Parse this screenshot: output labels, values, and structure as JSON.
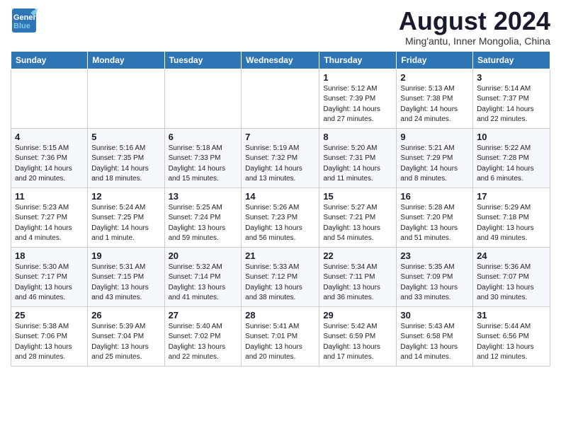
{
  "header": {
    "logo_line1": "General",
    "logo_line2": "Blue",
    "month_year": "August 2024",
    "location": "Ming'antu, Inner Mongolia, China"
  },
  "weekdays": [
    "Sunday",
    "Monday",
    "Tuesday",
    "Wednesday",
    "Thursday",
    "Friday",
    "Saturday"
  ],
  "weeks": [
    [
      {
        "day": "",
        "info": ""
      },
      {
        "day": "",
        "info": ""
      },
      {
        "day": "",
        "info": ""
      },
      {
        "day": "",
        "info": ""
      },
      {
        "day": "1",
        "info": "Sunrise: 5:12 AM\nSunset: 7:39 PM\nDaylight: 14 hours\nand 27 minutes."
      },
      {
        "day": "2",
        "info": "Sunrise: 5:13 AM\nSunset: 7:38 PM\nDaylight: 14 hours\nand 24 minutes."
      },
      {
        "day": "3",
        "info": "Sunrise: 5:14 AM\nSunset: 7:37 PM\nDaylight: 14 hours\nand 22 minutes."
      }
    ],
    [
      {
        "day": "4",
        "info": "Sunrise: 5:15 AM\nSunset: 7:36 PM\nDaylight: 14 hours\nand 20 minutes."
      },
      {
        "day": "5",
        "info": "Sunrise: 5:16 AM\nSunset: 7:35 PM\nDaylight: 14 hours\nand 18 minutes."
      },
      {
        "day": "6",
        "info": "Sunrise: 5:18 AM\nSunset: 7:33 PM\nDaylight: 14 hours\nand 15 minutes."
      },
      {
        "day": "7",
        "info": "Sunrise: 5:19 AM\nSunset: 7:32 PM\nDaylight: 14 hours\nand 13 minutes."
      },
      {
        "day": "8",
        "info": "Sunrise: 5:20 AM\nSunset: 7:31 PM\nDaylight: 14 hours\nand 11 minutes."
      },
      {
        "day": "9",
        "info": "Sunrise: 5:21 AM\nSunset: 7:29 PM\nDaylight: 14 hours\nand 8 minutes."
      },
      {
        "day": "10",
        "info": "Sunrise: 5:22 AM\nSunset: 7:28 PM\nDaylight: 14 hours\nand 6 minutes."
      }
    ],
    [
      {
        "day": "11",
        "info": "Sunrise: 5:23 AM\nSunset: 7:27 PM\nDaylight: 14 hours\nand 4 minutes."
      },
      {
        "day": "12",
        "info": "Sunrise: 5:24 AM\nSunset: 7:25 PM\nDaylight: 14 hours\nand 1 minute."
      },
      {
        "day": "13",
        "info": "Sunrise: 5:25 AM\nSunset: 7:24 PM\nDaylight: 13 hours\nand 59 minutes."
      },
      {
        "day": "14",
        "info": "Sunrise: 5:26 AM\nSunset: 7:23 PM\nDaylight: 13 hours\nand 56 minutes."
      },
      {
        "day": "15",
        "info": "Sunrise: 5:27 AM\nSunset: 7:21 PM\nDaylight: 13 hours\nand 54 minutes."
      },
      {
        "day": "16",
        "info": "Sunrise: 5:28 AM\nSunset: 7:20 PM\nDaylight: 13 hours\nand 51 minutes."
      },
      {
        "day": "17",
        "info": "Sunrise: 5:29 AM\nSunset: 7:18 PM\nDaylight: 13 hours\nand 49 minutes."
      }
    ],
    [
      {
        "day": "18",
        "info": "Sunrise: 5:30 AM\nSunset: 7:17 PM\nDaylight: 13 hours\nand 46 minutes."
      },
      {
        "day": "19",
        "info": "Sunrise: 5:31 AM\nSunset: 7:15 PM\nDaylight: 13 hours\nand 43 minutes."
      },
      {
        "day": "20",
        "info": "Sunrise: 5:32 AM\nSunset: 7:14 PM\nDaylight: 13 hours\nand 41 minutes."
      },
      {
        "day": "21",
        "info": "Sunrise: 5:33 AM\nSunset: 7:12 PM\nDaylight: 13 hours\nand 38 minutes."
      },
      {
        "day": "22",
        "info": "Sunrise: 5:34 AM\nSunset: 7:11 PM\nDaylight: 13 hours\nand 36 minutes."
      },
      {
        "day": "23",
        "info": "Sunrise: 5:35 AM\nSunset: 7:09 PM\nDaylight: 13 hours\nand 33 minutes."
      },
      {
        "day": "24",
        "info": "Sunrise: 5:36 AM\nSunset: 7:07 PM\nDaylight: 13 hours\nand 30 minutes."
      }
    ],
    [
      {
        "day": "25",
        "info": "Sunrise: 5:38 AM\nSunset: 7:06 PM\nDaylight: 13 hours\nand 28 minutes."
      },
      {
        "day": "26",
        "info": "Sunrise: 5:39 AM\nSunset: 7:04 PM\nDaylight: 13 hours\nand 25 minutes."
      },
      {
        "day": "27",
        "info": "Sunrise: 5:40 AM\nSunset: 7:02 PM\nDaylight: 13 hours\nand 22 minutes."
      },
      {
        "day": "28",
        "info": "Sunrise: 5:41 AM\nSunset: 7:01 PM\nDaylight: 13 hours\nand 20 minutes."
      },
      {
        "day": "29",
        "info": "Sunrise: 5:42 AM\nSunset: 6:59 PM\nDaylight: 13 hours\nand 17 minutes."
      },
      {
        "day": "30",
        "info": "Sunrise: 5:43 AM\nSunset: 6:58 PM\nDaylight: 13 hours\nand 14 minutes."
      },
      {
        "day": "31",
        "info": "Sunrise: 5:44 AM\nSunset: 6:56 PM\nDaylight: 13 hours\nand 12 minutes."
      }
    ]
  ]
}
